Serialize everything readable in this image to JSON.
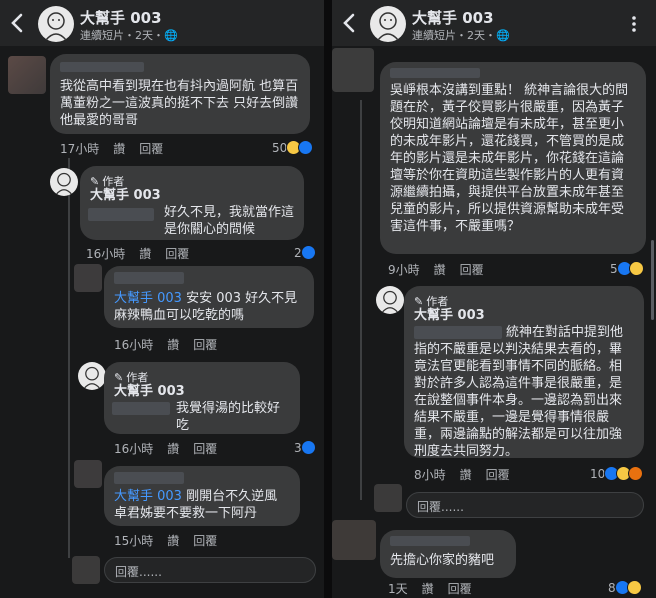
{
  "header": {
    "page_name": "大幫手 003",
    "subtitle_left": "連續短片・2天・",
    "subtitle_right": "連續短片・2天・"
  },
  "left": {
    "c1": {
      "text": "我從高中看到現在也有抖內過阿航 也算百萬董粉之一這波真的挺不下去 只好去倒讚他最愛的哥哥",
      "time": "17小時",
      "like": "讚",
      "reply": "回覆",
      "count": "50"
    },
    "r1": {
      "author_tag": "作者",
      "name": "大幫手 003",
      "text": "好久不見，我就當作這是你關心的問候",
      "time": "16小時",
      "like": "讚",
      "reply": "回覆",
      "count": "2"
    },
    "r2": {
      "mention": "大幫手 003",
      "text": " 安安 003 好久不見麻辣鴨血可以吃乾的嗎",
      "time": "16小時",
      "like": "讚",
      "reply": "回覆"
    },
    "r3": {
      "author_tag": "作者",
      "name": "大幫手 003",
      "text": "我覺得湯的比較好吃",
      "time": "16小時",
      "like": "讚",
      "reply": "回覆",
      "count": "3"
    },
    "r4": {
      "mention": "大幫手 003",
      "text": " 剛開台不久逆風卓君姊要不要救一下阿丹",
      "time": "15小時",
      "like": "讚",
      "reply": "回覆"
    },
    "reply_placeholder": "回覆......"
  },
  "right": {
    "c1": {
      "text": "吳崢根本沒講到重點！ 統神言論很大的問題在於，黃子佼買影片很嚴重，因為黃子佼明知道網站論壇是有未成年，甚至更小的未成年影片，還花錢買，不管買的是成年的影片還是未成年影片，你花錢在這論壇等於你在資助這些製作影片的人更有資源繼續拍攝，與提供平台放置未成年甚至兒童的影片，所以提供資源幫助未成年受害這件事，不嚴重嗎？",
      "time": "9小時",
      "like": "讚",
      "reply": "回覆",
      "count": "5"
    },
    "r1": {
      "author_tag": "作者",
      "name": "大幫手 003",
      "text": "統神在對話中提到他指的不嚴重是以判決結果去看的，畢竟法官更能看到事情不同的脈絡。相對於許多人認為這件事是很嚴重，是在說整個事件本身。一邊認為罰出來結果不嚴重，一邊是覺得事情很嚴重，兩邊論點的解法都是可以往加強刑度去共同努力。",
      "time": "8小時",
      "like": "讚",
      "reply": "回覆",
      "count": "10"
    },
    "reply_placeholder": "回覆......",
    "c2": {
      "text": "先擔心你家的豬吧",
      "time": "1天",
      "like": "讚",
      "reply": "回覆",
      "count": "8"
    }
  },
  "colors": {
    "background": "#18191a",
    "bubble": "#3a3b3c",
    "mention": "#4599ff",
    "like_blue": "#1877f2"
  }
}
